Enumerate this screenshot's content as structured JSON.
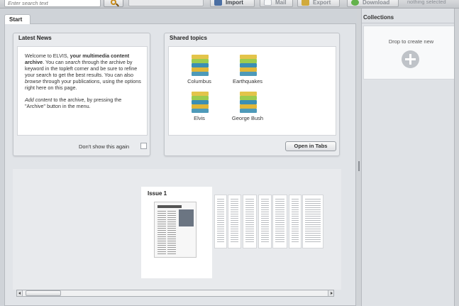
{
  "toolbar": {
    "search_placeholder": "Enter search text",
    "import_label": "Import",
    "mail_label": "Mail",
    "export_label": "Export",
    "download_label": "Download",
    "selection_status": "nothing selected"
  },
  "tabs": [
    {
      "label": "Start"
    }
  ],
  "news": {
    "title": "Latest News",
    "paragraph1_prefix": "Welcome to ELVIS, ",
    "paragraph1_bold": "your multimedia content archive",
    "paragraph1_mid1": ". You can ",
    "paragraph1_em1": "search",
    "paragraph1_mid2": " through the archive by keyword in the topleft corner and be sure to refine your search to get the best results. You can also ",
    "paragraph1_em2": "browse",
    "paragraph1_suffix": " through your publications, using the options right here on this page.",
    "paragraph2_em": "Add content",
    "paragraph2_suffix": " to the archive, by pressing the \"Archive\" button in the menu.",
    "dont_show_label": "Don't show this again",
    "dont_show_checked": false
  },
  "shared_topics": {
    "title": "Shared topics",
    "items": [
      {
        "label": "Columbus"
      },
      {
        "label": "Earthquakes"
      },
      {
        "label": "Elvis"
      },
      {
        "label": "George Bush"
      }
    ],
    "open_tabs_label": "Open in Tabs"
  },
  "coverflow": {
    "issue_label": "Issue 1"
  },
  "collections": {
    "title": "Collections",
    "drop_text": "Drop to create new"
  }
}
